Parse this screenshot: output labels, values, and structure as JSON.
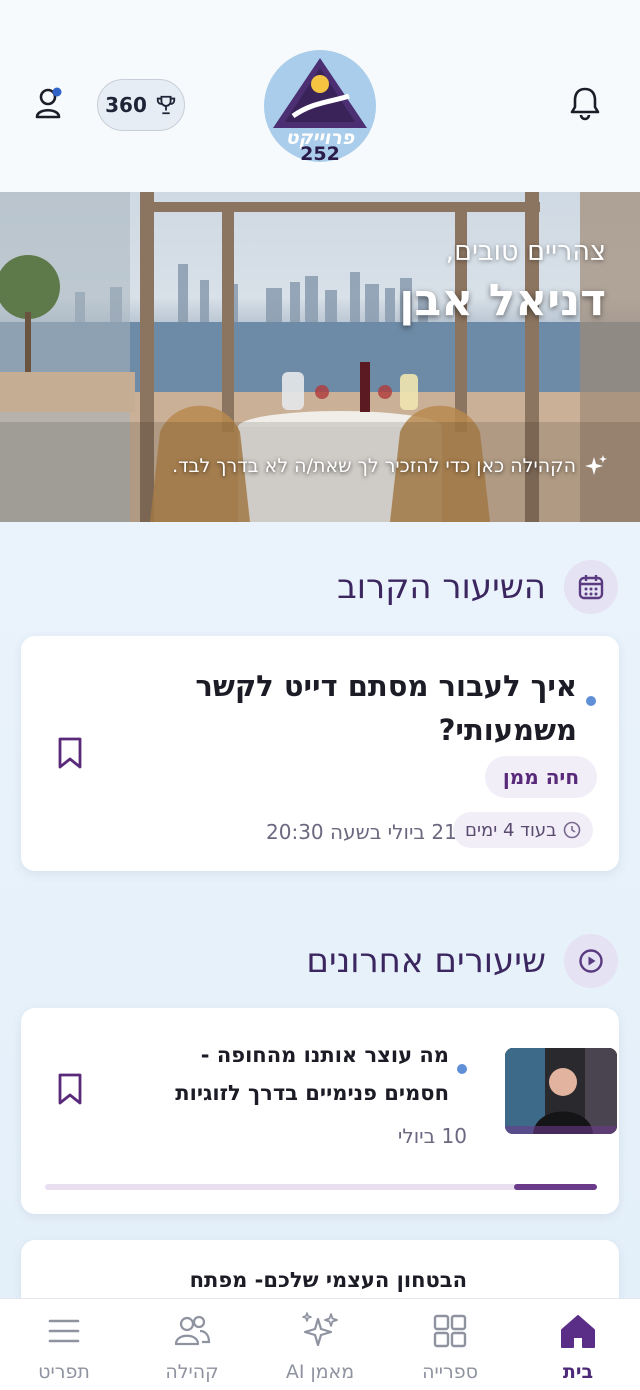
{
  "header": {
    "score": "360",
    "logo_text": "פרוייקט 252"
  },
  "hero": {
    "greeting": "צהריים טובים,",
    "username": "דניאל אבן",
    "tagline": "הקהילה כאן כדי להזכיר לך שאת/ה לא בדרך לבד."
  },
  "next_lesson_section": {
    "title": "השיעור הקרוב",
    "card": {
      "title_line1": "איך לעבור מסתם דייט לקשר",
      "title_line2": "משמעותי?",
      "instructor": "חיה ממן",
      "countdown": "בעוד 4 ימים",
      "datetime": "21 ביולי בשעה 20:30"
    }
  },
  "recent_section": {
    "title": "שיעורים אחרונים",
    "cards": [
      {
        "title_line1": "מה עוצר אותנו מהחופה -",
        "title_line2": "חסמים פנימיים בדרך לזוגיות",
        "date": "10 ביולי",
        "progress": 0.15
      },
      {
        "title_line1": "הבטחון העצמי שלכם- מפתח"
      }
    ]
  },
  "bottom_nav": {
    "items": [
      {
        "label": "בית",
        "icon": "home-icon",
        "active": true
      },
      {
        "label": "ספרייה",
        "icon": "library-grid-icon",
        "active": false
      },
      {
        "label": "מאמן AI",
        "icon": "ai-sparkles-icon",
        "active": false
      },
      {
        "label": "קהילה",
        "icon": "community-icon",
        "active": false
      },
      {
        "label": "תפריט",
        "icon": "menu-icon",
        "active": false
      }
    ]
  },
  "colors": {
    "brand_purple": "#4d2a78",
    "accent_dot": "#5f8fd6"
  }
}
